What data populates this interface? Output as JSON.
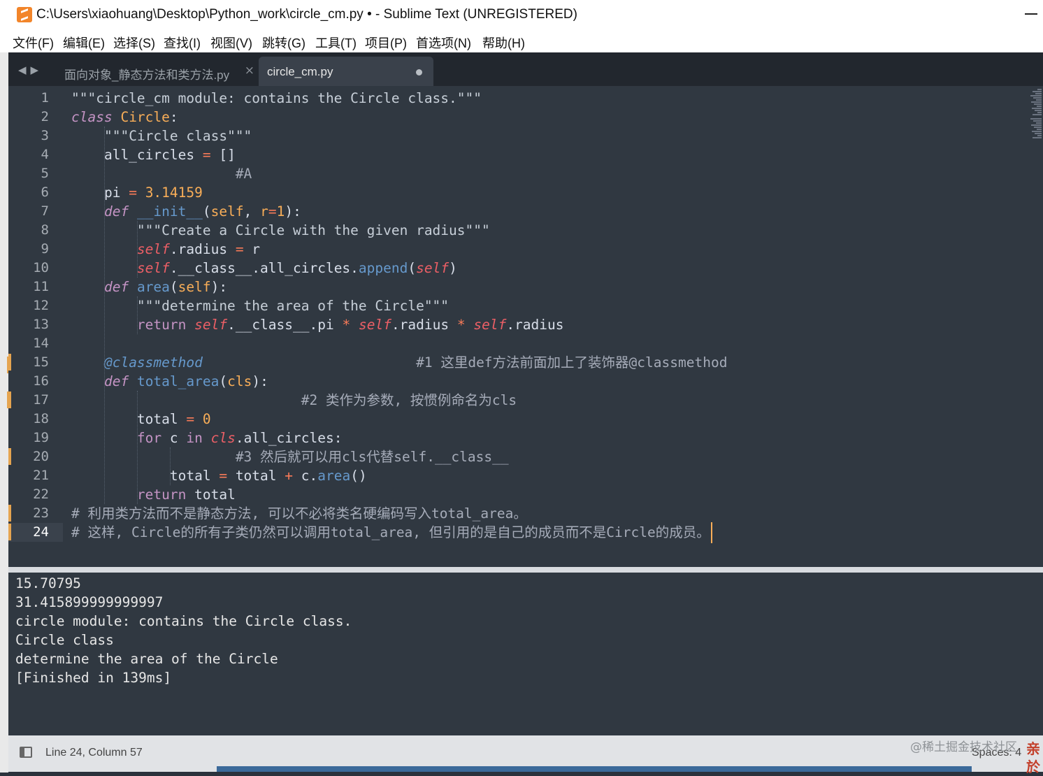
{
  "window": {
    "title": "C:\\Users\\xiaohuang\\Desktop\\Python_work\\circle_cm.py • - Sublime Text (UNREGISTERED)"
  },
  "menu": [
    {
      "label": "文件(F)"
    },
    {
      "label": "编辑(E)"
    },
    {
      "label": "选择(S)"
    },
    {
      "label": "查找(I)"
    },
    {
      "label": "视图(V)"
    },
    {
      "label": "跳转(G)"
    },
    {
      "label": "工具(T)"
    },
    {
      "label": "项目(P)"
    },
    {
      "label": "首选项(N)"
    },
    {
      "label": "帮助(H)"
    }
  ],
  "tabs": [
    {
      "label": "面向对象_静态方法和类方法.py",
      "close": "×",
      "active": false
    },
    {
      "label": "circle_cm.py",
      "active": true,
      "dirty": true
    }
  ],
  "editor": {
    "current_line": 24,
    "lines": [
      [
        [
          "str",
          "\"\"\"circle_cm module: contains the Circle class.\"\"\""
        ]
      ],
      [
        [
          "kw",
          "class"
        ],
        [
          "t",
          " "
        ],
        [
          "cls",
          "Circle"
        ],
        [
          "t",
          ":"
        ]
      ],
      [
        [
          "t",
          "    "
        ],
        [
          "str",
          "\"\"\"Circle class\"\"\""
        ]
      ],
      [
        [
          "t",
          "    all_circles "
        ],
        [
          "op",
          "="
        ],
        [
          "t",
          " []"
        ]
      ],
      [
        [
          "t",
          "                    "
        ],
        [
          "cmt",
          "#A"
        ]
      ],
      [
        [
          "t",
          "    pi "
        ],
        [
          "op",
          "="
        ],
        [
          "t",
          " "
        ],
        [
          "num",
          "3.14159"
        ]
      ],
      [
        [
          "t",
          "    "
        ],
        [
          "kw",
          "def"
        ],
        [
          "t",
          " "
        ],
        [
          "fn",
          "__init__"
        ],
        [
          "t",
          "("
        ],
        [
          "param",
          "self"
        ],
        [
          "t",
          ", "
        ],
        [
          "param",
          "r"
        ],
        [
          "op",
          "="
        ],
        [
          "num",
          "1"
        ],
        [
          "t",
          "):"
        ]
      ],
      [
        [
          "t",
          "        "
        ],
        [
          "str",
          "\"\"\"Create a Circle with the given radius\"\"\""
        ]
      ],
      [
        [
          "t",
          "        "
        ],
        [
          "self",
          "self"
        ],
        [
          "t",
          ".radius "
        ],
        [
          "op",
          "="
        ],
        [
          "t",
          " r"
        ]
      ],
      [
        [
          "t",
          "        "
        ],
        [
          "self",
          "self"
        ],
        [
          "t",
          ".__class__.all_circles."
        ],
        [
          "fn",
          "append"
        ],
        [
          "t",
          "("
        ],
        [
          "self",
          "self"
        ],
        [
          "t",
          ")"
        ]
      ],
      [
        [
          "t",
          "    "
        ],
        [
          "kw",
          "def"
        ],
        [
          "t",
          " "
        ],
        [
          "fn",
          "area"
        ],
        [
          "t",
          "("
        ],
        [
          "param",
          "self"
        ],
        [
          "t",
          "):"
        ]
      ],
      [
        [
          "t",
          "        "
        ],
        [
          "str",
          "\"\"\"determine the area of the Circle\"\"\""
        ]
      ],
      [
        [
          "t",
          "        "
        ],
        [
          "kw2",
          "return"
        ],
        [
          "t",
          " "
        ],
        [
          "self",
          "self"
        ],
        [
          "t",
          ".__class__.pi "
        ],
        [
          "op",
          "*"
        ],
        [
          "t",
          " "
        ],
        [
          "self",
          "self"
        ],
        [
          "t",
          ".radius "
        ],
        [
          "op",
          "*"
        ],
        [
          "t",
          " "
        ],
        [
          "self",
          "self"
        ],
        [
          "t",
          ".radius"
        ]
      ],
      [],
      [
        [
          "t",
          "    "
        ],
        [
          "dec",
          "@classmethod"
        ],
        [
          "t",
          "                          "
        ],
        [
          "cmt",
          "#1 这里def方法前面加上了装饰器@classmethod"
        ]
      ],
      [
        [
          "t",
          "    "
        ],
        [
          "kw",
          "def"
        ],
        [
          "t",
          " "
        ],
        [
          "fn",
          "total_area"
        ],
        [
          "t",
          "("
        ],
        [
          "param",
          "cls"
        ],
        [
          "t",
          "):"
        ]
      ],
      [
        [
          "t",
          "                            "
        ],
        [
          "cmt",
          "#2 类作为参数, 按惯例命名为cls"
        ]
      ],
      [
        [
          "t",
          "        total "
        ],
        [
          "op",
          "="
        ],
        [
          "t",
          " "
        ],
        [
          "num",
          "0"
        ]
      ],
      [
        [
          "t",
          "        "
        ],
        [
          "kw2",
          "for"
        ],
        [
          "t",
          " c "
        ],
        [
          "kw2",
          "in"
        ],
        [
          "t",
          " "
        ],
        [
          "self",
          "cls"
        ],
        [
          "t",
          ".all_circles:"
        ]
      ],
      [
        [
          "t",
          "                    "
        ],
        [
          "cmt",
          "#3 然后就可以用cls代替self.__class__"
        ]
      ],
      [
        [
          "t",
          "            total "
        ],
        [
          "op",
          "="
        ],
        [
          "t",
          " total "
        ],
        [
          "op",
          "+"
        ],
        [
          "t",
          " c."
        ],
        [
          "fn",
          "area"
        ],
        [
          "t",
          "()"
        ]
      ],
      [
        [
          "t",
          "        "
        ],
        [
          "kw2",
          "return"
        ],
        [
          "t",
          " total"
        ]
      ],
      [
        [
          "cmt",
          "# 利用类方法而不是静态方法, 可以不必将类名硬编码写入total_area。"
        ]
      ],
      [
        [
          "cmt",
          "# 这样, Circle的所有子类仍然可以调用total_area, 但引用的是自己的成员而不是Circle的成员。"
        ]
      ]
    ]
  },
  "output": {
    "lines": [
      "15.70795",
      "31.415899999999997",
      "circle module: contains the Circle class.",
      "Circle class",
      "determine the area of the Circle",
      "[Finished in 139ms]"
    ]
  },
  "status": {
    "position": "Line 24, Column 57",
    "indent": "Spaces: 4"
  },
  "watermark": {
    "text": "@稀土掘金技术社区",
    "side": "亲\n於"
  },
  "colors": {
    "editor_bg": "#303841",
    "tabbar_bg": "#22272e",
    "keyword": "#c594c5",
    "class_name": "#f9ae58",
    "function": "#6699cc",
    "self": "#ec5f66",
    "operator": "#f97b58",
    "modified_marker": "#e5a450"
  }
}
